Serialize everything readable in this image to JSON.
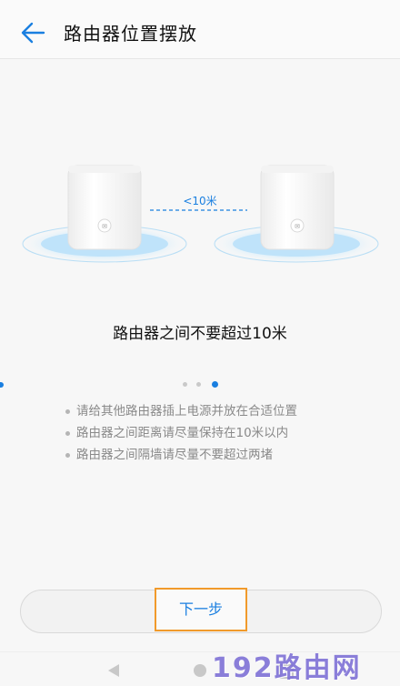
{
  "header": {
    "title": "路由器位置摆放",
    "back_icon": "arrow-left-icon"
  },
  "illustration": {
    "distance_label": "<10米"
  },
  "caption": "路由器之间不要超过10米",
  "pager": {
    "total": 3,
    "active_index": 2
  },
  "tips": [
    "请给其他路由器插上电源并放在合适位置",
    "路由器之间距离请尽量保持在10米以内",
    "路由器之间隔墙请尽量不要超过两堵"
  ],
  "next_button": {
    "label": "下一步"
  },
  "watermark": "192路由网",
  "colors": {
    "accent": "#1a7fe0",
    "highlight_border": "#f19a2b",
    "watermark": "#7c6ed6"
  }
}
